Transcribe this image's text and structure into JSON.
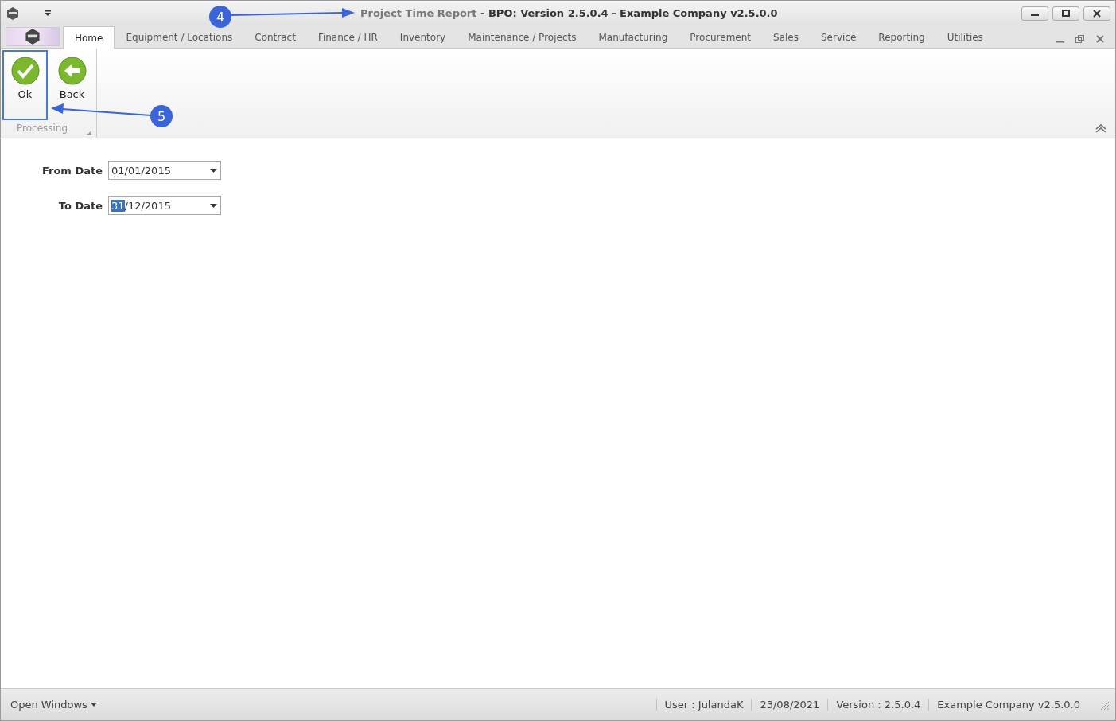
{
  "window": {
    "title_form": "Project Time Report",
    "title_app": "- BPO: Version 2.5.0.4 - Example Company v2.5.0.0"
  },
  "ribbon_tabs": [
    {
      "label": "Home",
      "selected": true
    },
    {
      "label": "Equipment / Locations",
      "selected": false
    },
    {
      "label": "Contract",
      "selected": false
    },
    {
      "label": "Finance / HR",
      "selected": false
    },
    {
      "label": "Inventory",
      "selected": false
    },
    {
      "label": "Maintenance / Projects",
      "selected": false
    },
    {
      "label": "Manufacturing",
      "selected": false
    },
    {
      "label": "Procurement",
      "selected": false
    },
    {
      "label": "Sales",
      "selected": false
    },
    {
      "label": "Service",
      "selected": false
    },
    {
      "label": "Reporting",
      "selected": false
    },
    {
      "label": "Utilities",
      "selected": false
    }
  ],
  "ribbon_group": {
    "label": "Processing",
    "buttons": [
      {
        "label": "Ok",
        "kind": "ok",
        "highlighted": true
      },
      {
        "label": "Back",
        "kind": "back",
        "highlighted": false
      }
    ]
  },
  "form": [
    {
      "label": "From Date",
      "parts": [
        {
          "text": "01/01/2015",
          "selected": false
        }
      ]
    },
    {
      "label": "To Date",
      "parts": [
        {
          "text": "31",
          "selected": true
        },
        {
          "text": "/12/2015",
          "selected": false
        }
      ]
    }
  ],
  "status_bar": {
    "open_windows": "Open Windows",
    "items": [
      "User : JulandaK",
      "23/08/2021",
      "Version : 2.5.0.4",
      "Example Company v2.5.0.0"
    ]
  },
  "callouts": [
    {
      "number": "4"
    },
    {
      "number": "5"
    }
  ]
}
